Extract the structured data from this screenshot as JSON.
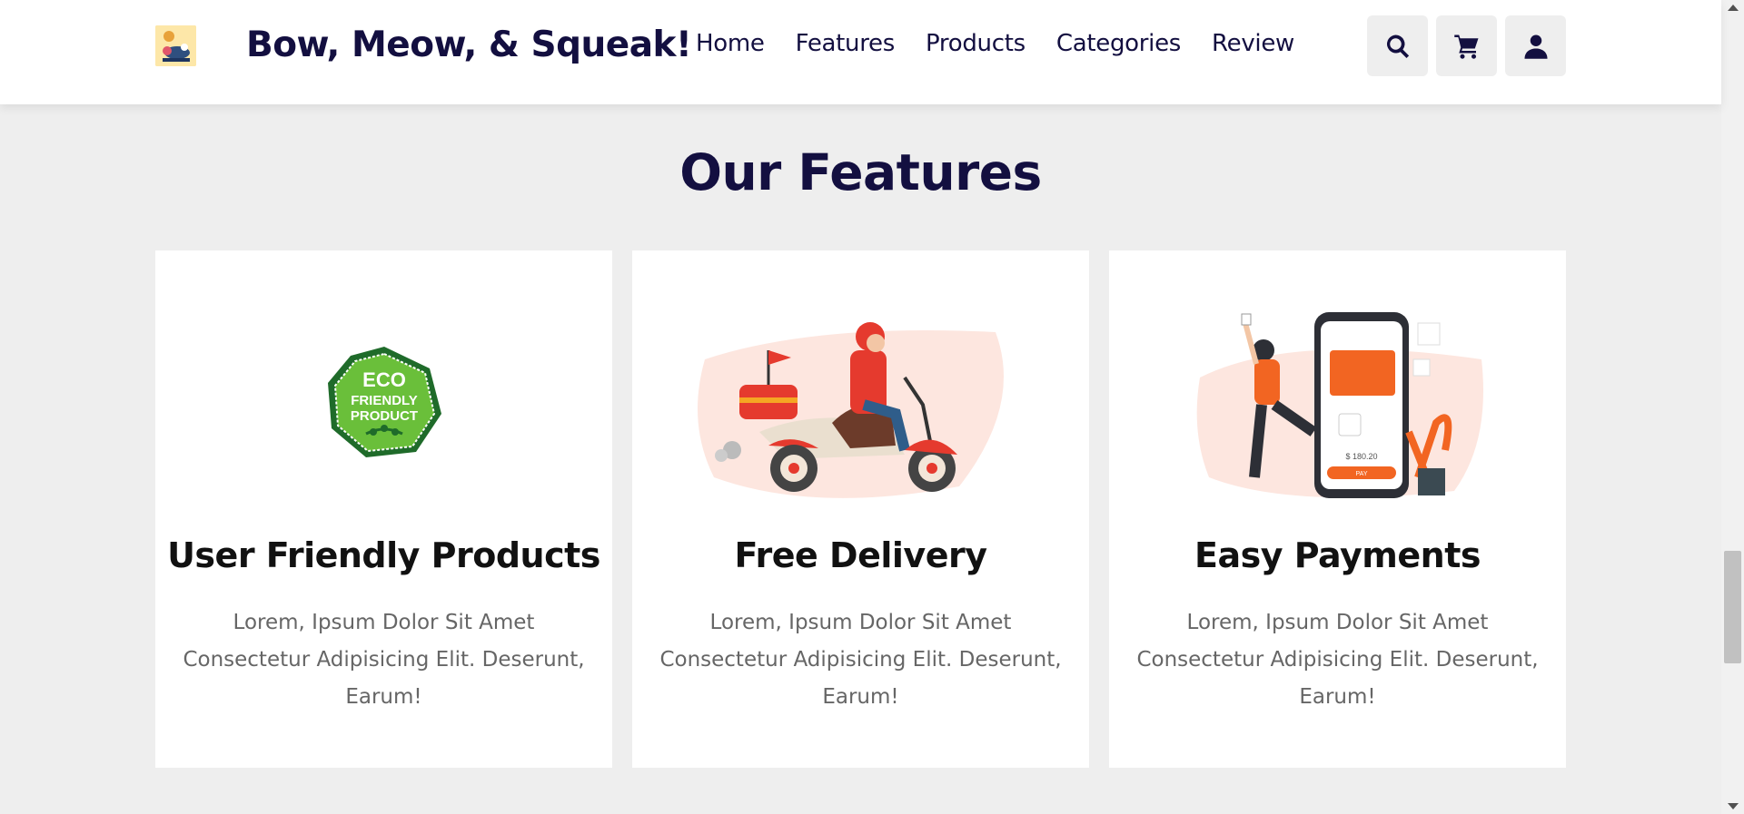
{
  "header": {
    "brand": "Bow, Meow, & Squeak!",
    "nav": [
      "Home",
      "Features",
      "Products",
      "Categories",
      "Review"
    ],
    "icons": [
      "search-icon",
      "cart-icon",
      "user-icon"
    ]
  },
  "features": {
    "title": "Our Features",
    "cards": [
      {
        "title": "User Friendly Products",
        "description": "Lorem, Ipsum Dolor Sit Amet Consectetur Adipisicing Elit. Deserunt, Earum!",
        "badge": [
          "ECO",
          "FRIENDLY",
          "PRODUCT"
        ]
      },
      {
        "title": "Free Delivery",
        "description": "Lorem, Ipsum Dolor Sit Amet Consectetur Adipisicing Elit. Deserunt, Earum!"
      },
      {
        "title": "Easy Payments",
        "description": "Lorem, Ipsum Dolor Sit Amet Consectetur Adipisicing Elit. Deserunt, Earum!",
        "phone_amount": "$ 180.20",
        "phone_button": "PAY"
      }
    ]
  },
  "colors": {
    "primary": "#130f40",
    "background": "#eeeeee",
    "card": "#ffffff",
    "accent_orange": "#f26522",
    "eco_green": "#6abf3a"
  }
}
